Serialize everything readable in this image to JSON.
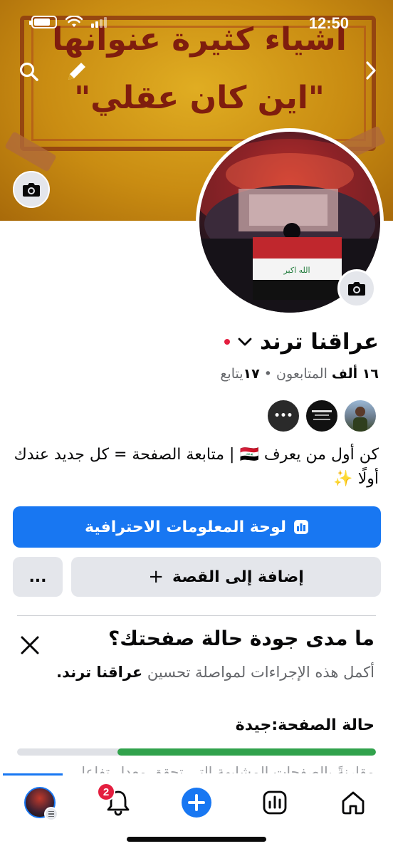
{
  "status_bar": {
    "time": "12:50"
  },
  "cover": {
    "line1": "اشياء كثيرة عنوانها",
    "line2": "\"اين كان عقلي\""
  },
  "icons": {
    "search": "search-icon",
    "edit": "pencil-icon",
    "next": "chevron-right-icon",
    "cover_camera": "camera-icon",
    "avatar_camera": "camera-icon"
  },
  "profile": {
    "name": "عراقنا ترند",
    "followers_count": "١٦ ألف",
    "followers_label": "المتابعون",
    "following_count": "١٧",
    "following_label": "يتابع",
    "separator": "•",
    "bio": "كن أول من يعرف 🇮🇶 | متابعة الصفحة = كل جديد عندك أولًا ✨"
  },
  "buttons": {
    "dashboard": "لوحة المعلومات الاحترافية",
    "add_story": "إضافة إلى القصة",
    "add_story_icon": "+",
    "more": "..."
  },
  "quality_card": {
    "title": "ما مدى جودة حالة صفحتك؟",
    "desc_prefix": "أكمل هذه الإجراءات لمواصلة تحسين",
    "desc_page": "عراقنا ترند.",
    "status": "حالة الصفحة:جيدة",
    "progress": 0.72,
    "faded_text": "مقارنةً بالصفحات المشابهة التي تحقق معدل تفاعل"
  },
  "bottom_nav": {
    "notifications_badge": "2"
  },
  "colors": {
    "accent": "#1877f2",
    "progress": "#31a24c",
    "badge": "#e41e3f"
  }
}
